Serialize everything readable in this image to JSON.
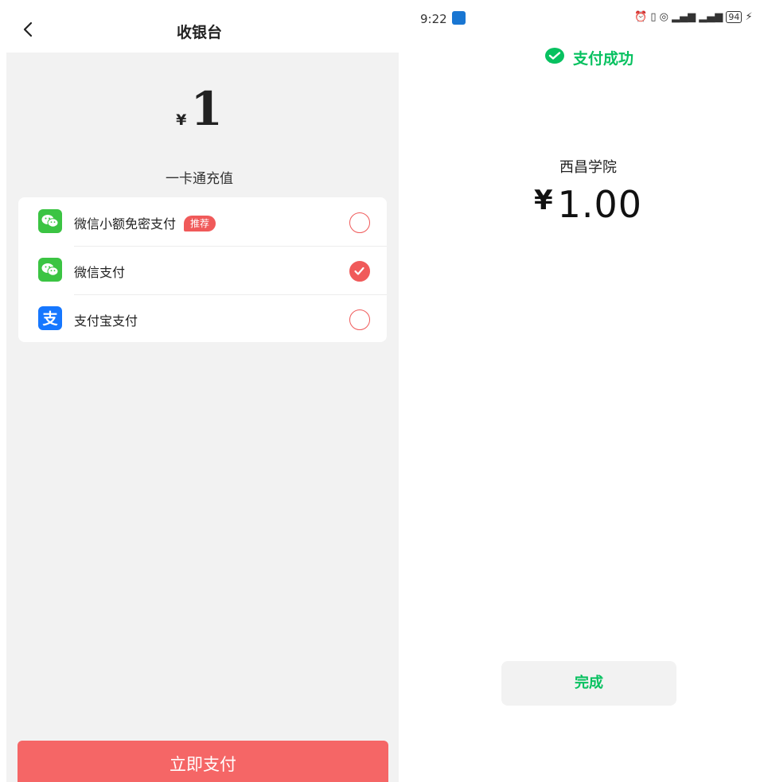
{
  "cashier": {
    "title": "收银台",
    "amount": {
      "currency": "¥",
      "value": "1"
    },
    "description": "一卡通充值",
    "methods": [
      {
        "label": "微信小额免密支付",
        "badge": "推荐",
        "icon": "wechat-icon",
        "selected": false
      },
      {
        "label": "微信支付",
        "icon": "wechat-icon",
        "selected": true
      },
      {
        "label": "支付宝支付",
        "icon": "alipay-icon",
        "selected": false
      }
    ],
    "pay_button": "立即支付"
  },
  "success": {
    "status_bar": {
      "time": "9:22",
      "battery": "94"
    },
    "status_label": "支付成功",
    "merchant": "西昌学院",
    "amount": {
      "currency": "¥",
      "value": "1.00"
    },
    "done_button": "完成"
  },
  "colors": {
    "accent_red": "#f56666",
    "wechat_green": "#07c160",
    "alipay_blue": "#1677ff"
  }
}
